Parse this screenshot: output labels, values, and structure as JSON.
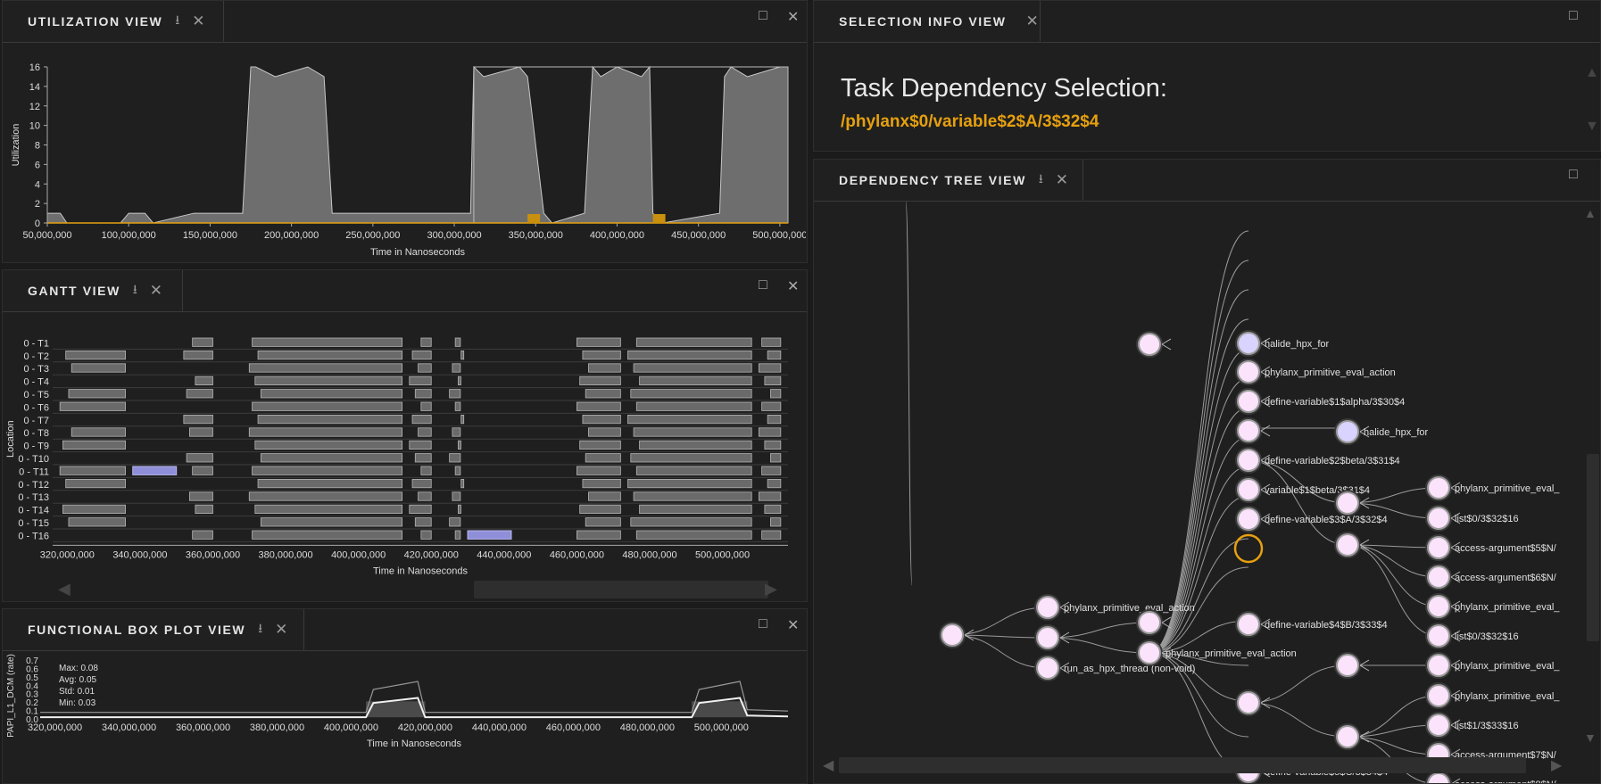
{
  "panels": {
    "utilization": {
      "title": "UTILIZATION VIEW"
    },
    "gantt": {
      "title": "GANTT VIEW"
    },
    "boxplot": {
      "title": "FUNCTIONAL BOX PLOT VIEW"
    },
    "selection": {
      "title": "SELECTION INFO VIEW",
      "heading": "Task Dependency Selection:",
      "selected_path": "/phylanx$0/variable$2$A/3$32$4"
    },
    "tree": {
      "title": "DEPENDENCY TREE VIEW"
    }
  },
  "utilization_chart": {
    "type": "area",
    "ylabel": "Utilization",
    "xlabel": "Time in Nanoseconds",
    "y_ticks": [
      "0",
      "2",
      "4",
      "6",
      "8",
      "10",
      "12",
      "14",
      "16"
    ],
    "x_ticks": [
      "50,000,000",
      "100,000,000",
      "150,000,000",
      "200,000,000",
      "250,000,000",
      "300,000,000",
      "350,000,000",
      "400,000,000",
      "450,000,000",
      "500,000,000"
    ]
  },
  "gantt_chart": {
    "ylabel": "Location",
    "xlabel": "Time in Nanoseconds",
    "rows": [
      "0 - T1",
      "0 - T2",
      "0 - T3",
      "0 - T4",
      "0 - T5",
      "0 - T6",
      "0 - T7",
      "0 - T8",
      "0 - T9",
      "0 - T10",
      "0 - T11",
      "0 - T12",
      "0 - T13",
      "0 - T14",
      "0 - T15",
      "0 - T16"
    ],
    "x_ticks": [
      "320,000,000",
      "340,000,000",
      "360,000,000",
      "380,000,000",
      "400,000,000",
      "420,000,000",
      "440,000,000",
      "460,000,000",
      "480,000,000",
      "500,000,000"
    ]
  },
  "boxplot_chart": {
    "ylabel": "PAPI_L1_DCM (rate)",
    "xlabel": "Time in Nanoseconds",
    "y_ticks": [
      "0.7",
      "0.6",
      "0.5",
      "0.4",
      "0.3",
      "0.2",
      "0.1",
      "0.0"
    ],
    "stats": [
      "Max: 0.08",
      "Avg: 0.05",
      "Std: 0.01",
      "Min: 0.03"
    ],
    "x_ticks": [
      "320,000,000",
      "340,000,000",
      "360,000,000",
      "380,000,000",
      "400,000,000",
      "420,000,000",
      "440,000,000",
      "460,000,000",
      "480,000,000",
      "500,000,000"
    ]
  },
  "chart_data": [
    {
      "type": "area",
      "ylabel": "Utilization",
      "xlabel": "Time in Nanoseconds",
      "ylim": [
        0,
        16
      ],
      "xlim": [
        50000000,
        505000000
      ],
      "x": [
        50000000,
        58000000,
        62000000,
        95000000,
        100000000,
        110000000,
        115000000,
        140000000,
        170000000,
        175000000,
        178000000,
        190000000,
        210000000,
        220000000,
        225000000,
        232000000,
        262000000,
        310000000,
        312000000,
        318000000,
        340000000,
        345000000,
        355000000,
        360000000,
        380000000,
        385000000,
        390000000,
        400000000,
        415000000,
        420000000,
        422000000,
        428000000,
        463000000,
        466000000,
        470000000,
        480000000,
        500000000,
        505000000
      ],
      "y": [
        1,
        1,
        0,
        0,
        1,
        1,
        0,
        1,
        1,
        16,
        16,
        15,
        16,
        15,
        1,
        1,
        1,
        1,
        16,
        15,
        16,
        15,
        1,
        0,
        1,
        16,
        15,
        16,
        15,
        16,
        1,
        0,
        1,
        15,
        16,
        15,
        16,
        16
      ]
    },
    {
      "type": "line",
      "ylabel": "PAPI_L1_DCM (rate)",
      "xlabel": "Time in Nanoseconds",
      "ylim": [
        0,
        0.7
      ],
      "xlim": [
        316000000,
        518000000
      ],
      "series": [
        {
          "x": [
            316000000,
            340000000,
            360000000,
            380000000,
            404000000,
            406000000,
            418000000,
            420000000,
            460000000,
            492000000,
            494000000,
            505000000,
            507000000,
            518000000
          ],
          "y": [
            0.03,
            0.03,
            0.03,
            0.03,
            0.03,
            0.2,
            0.26,
            0.03,
            0.03,
            0.03,
            0.2,
            0.26,
            0.05,
            0.04
          ]
        }
      ]
    }
  ]
}
